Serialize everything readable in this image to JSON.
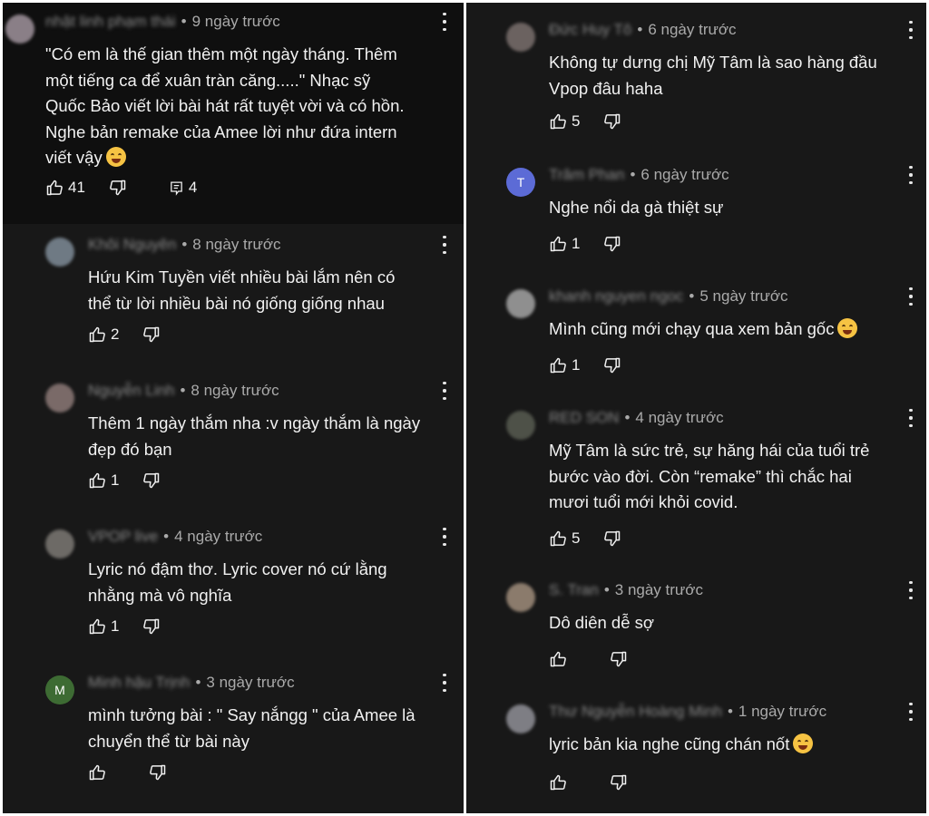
{
  "left_comments": [
    {
      "author": "nhật linh phạm thái",
      "time": "9 ngày trước",
      "lines": [
        "\"Có em là thế gian thêm một ngày tháng. Thêm",
        "một tiếng ca để xuân tràn căng.....\" Nhạc sỹ",
        "Quốc Bảo viết lời bài hát rất tuyệt vời và có hồn.",
        "Nghe bản remake của Amee lời như đứa intern",
        "viết vậy"
      ],
      "emoji": "sweat-smile-emoji",
      "likes": "41",
      "replies": "4"
    },
    {
      "author": "Khôi Nguyên",
      "time": "8 ngày trước",
      "lines": [
        "Hứu Kim Tuyền viết nhiều bài lắm nên có",
        "thể từ lời nhiều bài nó giống giống nhau"
      ],
      "likes": "2"
    },
    {
      "author": "Nguyễn Linh",
      "time": "8 ngày trước",
      "lines": [
        "Thêm 1 ngày thắm nha :v ngày thắm là ngày",
        "đẹp đó bạn"
      ],
      "likes": "1"
    },
    {
      "author": "VPOP live",
      "time": "4 ngày trước",
      "lines": [
        "Lyric nó đậm thơ. Lyric cover nó cứ lằng",
        "nhằng mà vô nghĩa"
      ],
      "likes": "1"
    },
    {
      "author": "Minh hậu Trịnh",
      "time": "3 ngày trước",
      "avatar_letter": "M",
      "lines": [
        "mình tưởng bài : \" Say nắngg \" của Amee là",
        "chuyển thể từ bài này"
      ],
      "likes": ""
    }
  ],
  "right_comments": [
    {
      "author": "Đức Huy Tô",
      "time": "6 ngày trước",
      "lines": [
        "Không tự dưng chị Mỹ Tâm là sao hàng đầu",
        "Vpop đâu haha"
      ],
      "likes": "5"
    },
    {
      "author": "Trâm Phan",
      "time": "6 ngày trước",
      "avatar_letter": "T",
      "lines": [
        "Nghe nổi da gà thiệt sự"
      ],
      "likes": "1"
    },
    {
      "author": "khanh nguyen ngoc",
      "time": "5 ngày trước",
      "lines": [
        "Mình cũng mới chạy qua xem bản gốc"
      ],
      "emoji": "rofl-emoji",
      "likes": "1"
    },
    {
      "author": "RED SON",
      "time": "4 ngày trước",
      "lines": [
        "Mỹ Tâm là sức trẻ, sự hăng hái của tuổi trẻ",
        "bước vào đời. Còn “remake” thì chắc hai",
        "mươi tuổi mới khỏi covid."
      ],
      "likes": "5"
    },
    {
      "author": "S. Tran",
      "time": "3 ngày trước",
      "lines": [
        "Dô diên dễ sợ"
      ],
      "likes": ""
    },
    {
      "author": "Thư Nguyễn Hoàng Minh",
      "time": "1 ngày trước",
      "lines": [
        "lyric bản kia nghe cũng chán nốt"
      ],
      "emoji": "yawn-emoji",
      "likes": ""
    }
  ],
  "colors": {
    "panel_bg": "#181818",
    "highlight_bg": "#0f0f0f",
    "meta": "#aaaaaa",
    "text": "#f1f1f1"
  }
}
